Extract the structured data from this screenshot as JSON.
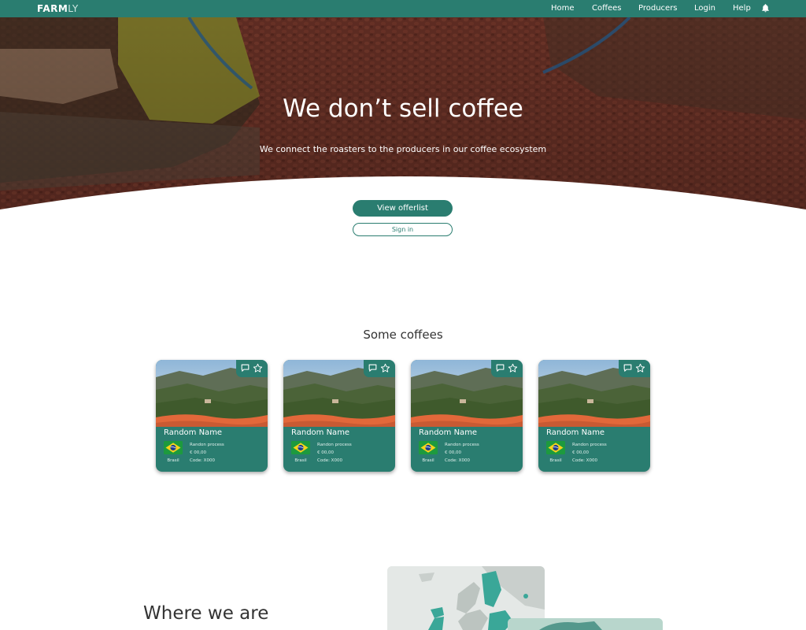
{
  "nav": {
    "logo_bold": "FARM",
    "logo_light": "LY",
    "links": [
      "Home",
      "Coffees",
      "Producers",
      "Login",
      "Help"
    ]
  },
  "hero": {
    "title": "We don’t sell coffee",
    "subtitle": "We connect the roasters to the producers in our coffee ecosystem",
    "primary_button": "View offerlist",
    "secondary_button": "Sign in"
  },
  "coffees": {
    "title": "Some coffees",
    "items": [
      {
        "name": "Random Name",
        "country": "Brasil",
        "process": "Randon process",
        "price": "€ 00,00",
        "code": "Code: X000"
      },
      {
        "name": "Random Name",
        "country": "Brasil",
        "process": "Randon process",
        "price": "€ 00,00",
        "code": "Code: X000"
      },
      {
        "name": "Random Name",
        "country": "Brasil",
        "process": "Randon process",
        "price": "€ 00,00",
        "code": "Code: X000"
      },
      {
        "name": "Random Name",
        "country": "Brasil",
        "process": "Randon process",
        "price": "€ 00,00",
        "code": "Code: X000"
      }
    ]
  },
  "where": {
    "title": "Where we are"
  },
  "colors": {
    "brand": "#2a7d70",
    "accent": "#e2683a",
    "text": "#333333"
  },
  "icons": [
    "bell-icon",
    "comment-icon",
    "star-icon",
    "brazil-flag-icon"
  ]
}
